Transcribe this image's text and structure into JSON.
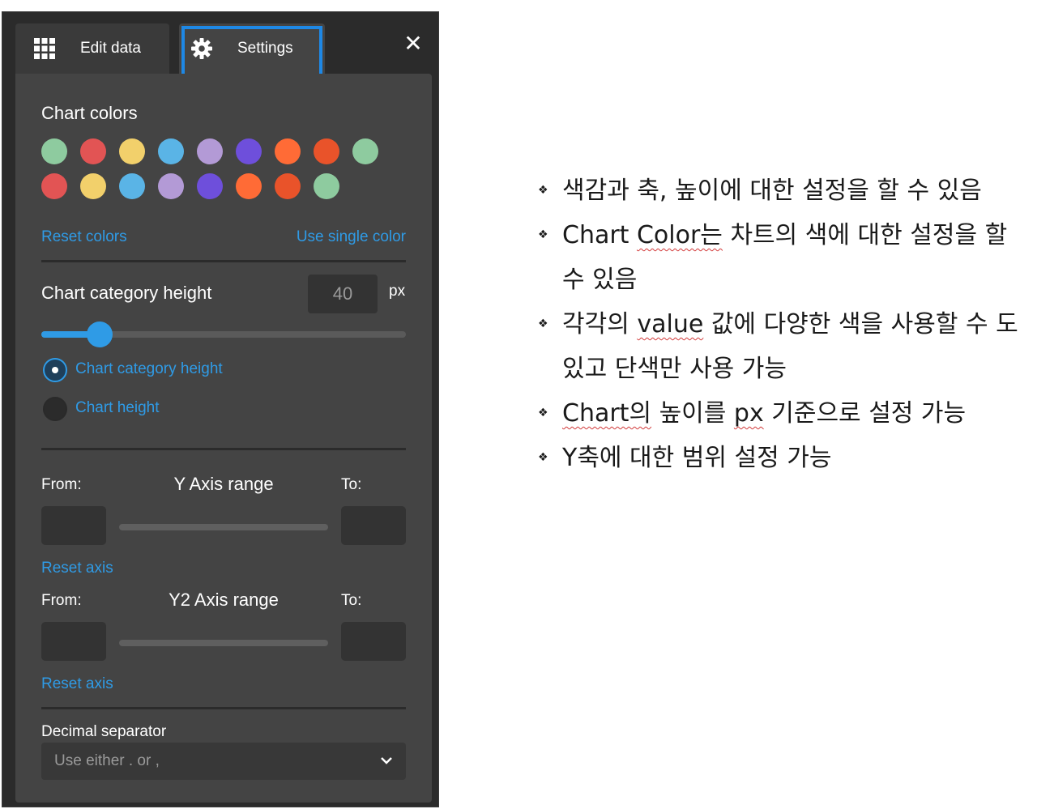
{
  "tabs": {
    "edit_label": "Edit data",
    "settings_label": "Settings",
    "close_symbol": "✕"
  },
  "chart_colors": {
    "title": "Chart colors",
    "row1": [
      "#8ecb9f",
      "#e25454",
      "#f2d06b",
      "#5ab4e6",
      "#b39ad6",
      "#6e4fdb",
      "#ff6b36",
      "#e9532a",
      "#8ecb9f"
    ],
    "row2": [
      "#e25454",
      "#f2d06b",
      "#5ab4e6",
      "#b39ad6",
      "#6e4fdb",
      "#ff6b36",
      "#e9532a",
      "#8ecb9f"
    ],
    "reset_label": "Reset colors",
    "single_label": "Use single color"
  },
  "category_height": {
    "title": "Chart category height",
    "value": "40",
    "unit": "px",
    "slider_fraction": 0.16,
    "options": [
      {
        "label": "Chart category height",
        "selected": true
      },
      {
        "label": "Chart height",
        "selected": false
      }
    ]
  },
  "y_axis": {
    "from_label": "From:",
    "title": "Y Axis range",
    "to_label": "To:",
    "reset_label": "Reset axis"
  },
  "y2_axis": {
    "from_label": "From:",
    "title": "Y2 Axis range",
    "to_label": "To:",
    "reset_label": "Reset axis"
  },
  "decimal": {
    "title": "Decimal separator",
    "value": "Use either . or ,"
  },
  "notes": [
    {
      "parts": [
        {
          "t": "색감과 축, 높이에 대한 설정을 할 수 있음",
          "s": false
        }
      ]
    },
    {
      "parts": [
        {
          "t": "Chart ",
          "s": false
        },
        {
          "t": "Color는",
          "s": true
        },
        {
          "t": " 차트의 색에 대한 설정을 할 수 있음",
          "s": false
        }
      ]
    },
    {
      "parts": [
        {
          "t": "각각의 ",
          "s": false
        },
        {
          "t": "value",
          "s": true
        },
        {
          "t": " 값에 다양한 색을 사용할 수 도 있고 단색만 사용 가능",
          "s": false
        }
      ]
    },
    {
      "parts": [
        {
          "t": "Chart의",
          "s": true
        },
        {
          "t": " 높이를 ",
          "s": false
        },
        {
          "t": "px",
          "s": true
        },
        {
          "t": " 기준으로 설정 가능",
          "s": false
        }
      ]
    },
    {
      "parts": [
        {
          "t": "Y축에 대한 범위 설정 가능",
          "s": false
        }
      ]
    }
  ],
  "bullet_symbol": "❖",
  "accent_color": "#1e88e5",
  "link_color": "#2f9be6"
}
